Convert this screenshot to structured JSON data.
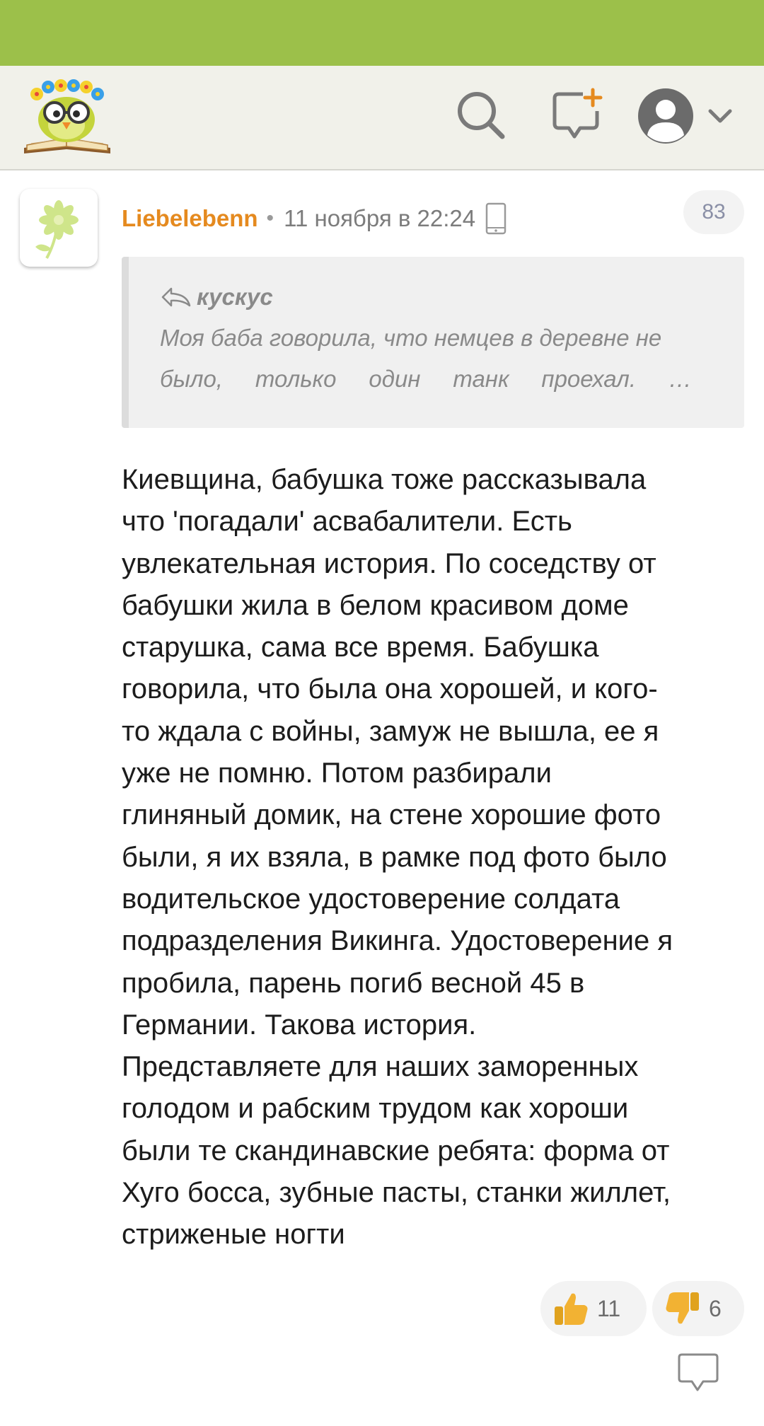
{
  "header": {
    "logo_icon": "owl-on-book-logo",
    "search_icon": "search-icon",
    "new_post_icon": "chat-plus-icon",
    "profile_icon": "user-avatar-icon",
    "menu_icon": "chevron-down-icon"
  },
  "comment": {
    "author": "Liebelebenn",
    "separator": "•",
    "time": "11 ноября в 22:24",
    "device_icon": "phone-icon",
    "counter": "83",
    "quote": {
      "author": "кускус",
      "line1": "Моя баба говорила, что немцев в деревне не",
      "line2_words": [
        "было,",
        "только",
        "один",
        "танк",
        "проехал.",
        "…"
      ]
    },
    "body_lines": [
      "Киевщина, бабушка тоже рассказывала",
      "что 'погадали' асвабалители. Есть",
      "увлекательная история. По соседству от",
      "бабушки жила в белом красивом доме",
      "старушка, сама все время. Бабушка",
      "говорила, что была она хорошей, и кого-",
      "то ждала с войны, замуж не вышла, ее я",
      "уже не помню. Потом разбирали",
      "глиняный домик, на стене хорошие фото",
      "были, я их взяла, в рамке под фото было",
      "водительское удостоверение солдата",
      "подразделения Викинга. Удостоверение я",
      "пробила, парень погиб весной 45 в",
      "Германии. Такова история.",
      "Представляете для наших заморенных",
      "голодом и рабским трудом как хороши",
      "были те скандинавские ребята: форма от",
      "Хуго босса, зубные пасты, станки жиллет,",
      "стриженые ногти"
    ],
    "likes": "11",
    "dislikes": "6",
    "reply_icon": "reply-bubble-icon"
  },
  "colors": {
    "status_bar": "#9cc04a",
    "app_bar": "#f1f1ea",
    "author": "#e58a1f",
    "thumb": "#f2b233"
  }
}
